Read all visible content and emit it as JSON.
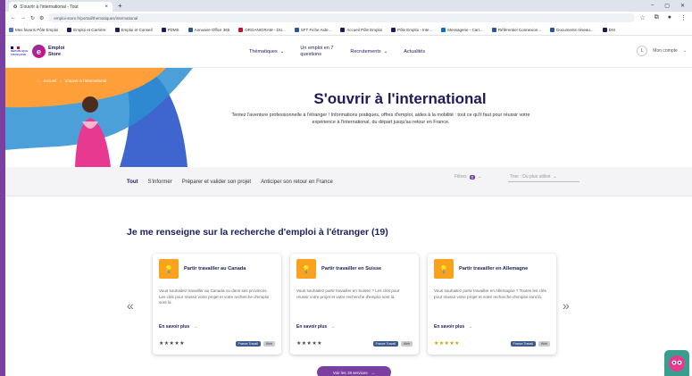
{
  "browser": {
    "tab_title": "S'ouvrir à l'international - Tout",
    "url": "emploi-store.fr/portail/thematiques/international",
    "bookmarks": [
      {
        "label": "Mes favoris Pôle Emploi",
        "color": "#4a78c8"
      },
      {
        "label": "Emploi et Carrière",
        "color": "#1c1c5a"
      },
      {
        "label": "Emploi et Conseil",
        "color": "#1c1c5a"
      },
      {
        "label": "PDMS",
        "color": "#1c1c5a"
      },
      {
        "label": "Annuaire Office 365",
        "color": "#2b579a"
      },
      {
        "label": "ORGANIGRAM - DU...",
        "color": "#c8102e"
      },
      {
        "label": "SFT Fiche Aide...",
        "color": "#2b579a"
      },
      {
        "label": "Accueil Pôle Emploi",
        "color": "#1c1c5a"
      },
      {
        "label": "Pôle Emploi - Inte...",
        "color": "#1c1c5a"
      },
      {
        "label": "Messagerie - Carr...",
        "color": "#0a6fc2"
      },
      {
        "label": "Référentiel Connexion...",
        "color": "#2b579a"
      },
      {
        "label": "Documents réseau...",
        "color": "#2b579a"
      },
      {
        "label": "DSI",
        "color": "#1c1c5a"
      }
    ]
  },
  "header": {
    "logo_line1": "Emploi",
    "logo_line2": "Store",
    "republic_text": "RÉPUBLIQUE FRANÇAISE",
    "nav": [
      {
        "label": "Thématiques",
        "dropdown": true
      },
      {
        "label": "Un emploi en 7 questions",
        "dropdown": false
      },
      {
        "label": "Recrutements",
        "dropdown": true
      },
      {
        "label": "Actualités",
        "dropdown": false
      }
    ],
    "avatar_letter": "L",
    "account_label": "Mon compte"
  },
  "hero": {
    "breadcrumb": [
      "Accueil",
      "S'ouvrir à l'international"
    ],
    "title": "S'ouvrir à l'international",
    "description": "Tentez l'aventure professionnelle à l'étranger ! Informations pratiques, offres d'emploi, aides à la mobilité : tout ce qu'il faut pour réussir votre expérience à l'international, du départ jusqu'au retour en France."
  },
  "filters": {
    "tabs": [
      "Tout",
      "S'informer",
      "Préparer et valider son projet",
      "Anticiper son retour en France"
    ],
    "active_tab": 0,
    "filter_label": "Filtres",
    "filter_count": "0",
    "sort_label": "Trier : Du plus utilisé"
  },
  "results": {
    "title_strong": "Je me renseigne",
    "title_rest": "sur la recherche d'emploi à l'étranger (19)",
    "cards": [
      {
        "title": "Partir travailler au Canada",
        "description": "Vous souhaitez travailler au Canada ou dans ses provinces. Les clés pour réussir votre projet et votre recherche d'emploi sont là.",
        "link": "En savoir plus",
        "rating": 0.8,
        "stars_color": "#4a4a4a",
        "tags": [
          "France Travail",
          "Web"
        ]
      },
      {
        "title": "Partir travailler en Suisse",
        "description": "Vous souhaitez partir travailler en Suisse ? Les clés pour réussir votre projet et votre recherche d'emploi sont là.",
        "link": "En savoir plus",
        "rating": 0.8,
        "stars_color": "#4a4a4a",
        "tags": [
          "France Travail",
          "Web"
        ]
      },
      {
        "title": "Partir travailler en Allemagne",
        "description": "Vous souhaitez partir travailler en Allemagne ? Toutes les clés pour réussir votre projet et votre recherche d'emploi sont là.",
        "link": "En savoir plus",
        "rating": 1.0,
        "stars_color": "#c8a400",
        "tags": [
          "France Travail",
          "Web"
        ]
      }
    ],
    "prev_icon": "«",
    "next_icon": "»",
    "more_button": "Voir les 19 services"
  },
  "colors": {
    "brand_purple": "#7b3fa0",
    "navy": "#1c1c5a",
    "hero_blue": "#3f66cf",
    "card_icon": "#f8a21d"
  }
}
